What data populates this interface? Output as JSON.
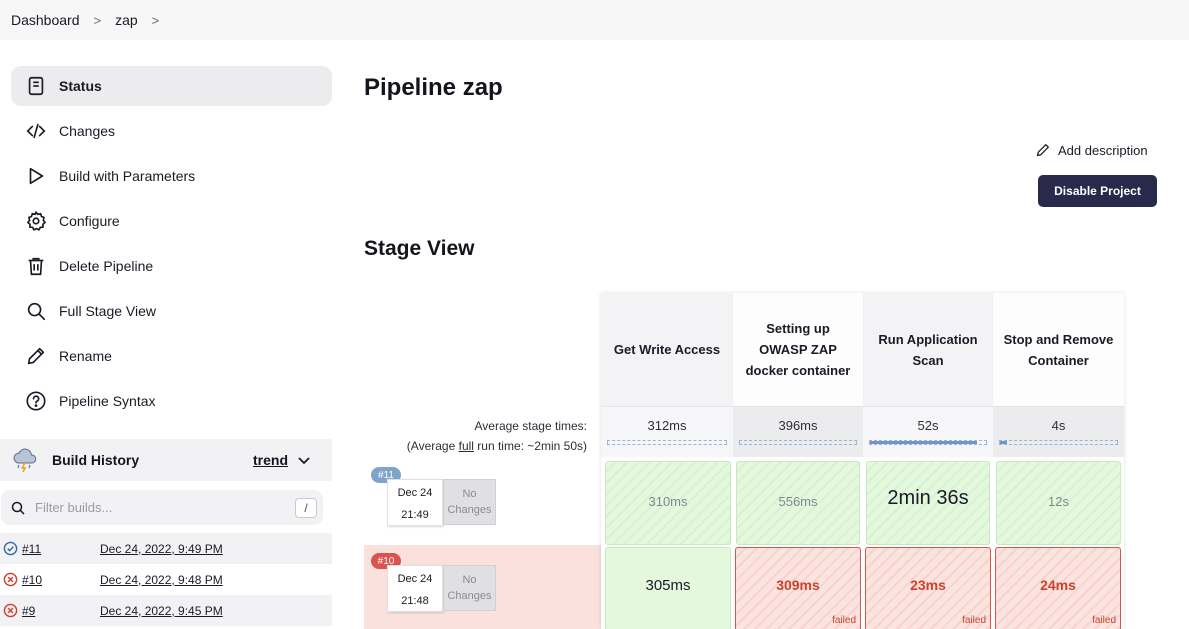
{
  "breadcrumb": {
    "items": [
      "Dashboard",
      "zap"
    ],
    "separator": ">"
  },
  "sidebar": {
    "items": [
      {
        "label": "Status",
        "icon": "document-icon",
        "active": true
      },
      {
        "label": "Changes",
        "icon": "code-icon"
      },
      {
        "label": "Build with Parameters",
        "icon": "play-icon"
      },
      {
        "label": "Configure",
        "icon": "gear-icon"
      },
      {
        "label": "Delete Pipeline",
        "icon": "trash-icon"
      },
      {
        "label": "Full Stage View",
        "icon": "search-icon"
      },
      {
        "label": "Rename",
        "icon": "pencil-icon"
      },
      {
        "label": "Pipeline Syntax",
        "icon": "help-icon"
      }
    ]
  },
  "build_history": {
    "title": "Build History",
    "trend_label": "trend",
    "filter_placeholder": "Filter builds...",
    "filter_shortcut": "/",
    "builds": [
      {
        "number": "#11",
        "date": "Dec 24, 2022, 9:49 PM",
        "status": "success"
      },
      {
        "number": "#10",
        "date": "Dec 24, 2022, 9:48 PM",
        "status": "failed"
      },
      {
        "number": "#9",
        "date": "Dec 24, 2022, 9:45 PM",
        "status": "failed"
      }
    ]
  },
  "main": {
    "title": "Pipeline zap",
    "add_description": "Add description",
    "disable_button": "Disable Project",
    "stage_view_title": "Stage View"
  },
  "stage_view": {
    "avg_label_1": "Average stage times:",
    "avg_label_2a": "(Average ",
    "avg_label_2b": "full",
    "avg_label_2c": " run time: ~2min 50s)",
    "stages": [
      {
        "name": "Get Write Access",
        "avg": "312ms",
        "avg_fraction": 0.0
      },
      {
        "name": "Setting up OWASP ZAP docker container",
        "avg": "396ms",
        "avg_fraction": 0.0
      },
      {
        "name": "Run Application Scan",
        "avg": "52s",
        "avg_fraction": 0.92
      },
      {
        "name": "Stop and Remove Container",
        "avg": "4s",
        "avg_fraction": 0.06
      }
    ],
    "runs": [
      {
        "badge": "#11",
        "date": "Dec 24",
        "time": "21:49",
        "changes": "No Changes",
        "status": "success",
        "cells": [
          {
            "value": "310ms",
            "status": "success"
          },
          {
            "value": "556ms",
            "status": "success"
          },
          {
            "value": "2min 36s",
            "status": "success"
          },
          {
            "value": "12s",
            "status": "success"
          }
        ]
      },
      {
        "badge": "#10",
        "date": "Dec 24",
        "time": "21:48",
        "changes": "No Changes",
        "status": "failed",
        "cells": [
          {
            "value": "305ms",
            "status": "success"
          },
          {
            "value": "309ms",
            "status": "failed",
            "note": "failed"
          },
          {
            "value": "23ms",
            "status": "failed",
            "note": "failed"
          },
          {
            "value": "24ms",
            "status": "failed",
            "note": "failed"
          }
        ]
      }
    ]
  },
  "colors": {
    "accent": "#272a4a",
    "success_bg": "#e4f8de",
    "failed_bg": "#fbe3df",
    "failed_text": "#c9432f",
    "badge_blue": "#7fa4cc",
    "badge_red": "#d9534f"
  }
}
